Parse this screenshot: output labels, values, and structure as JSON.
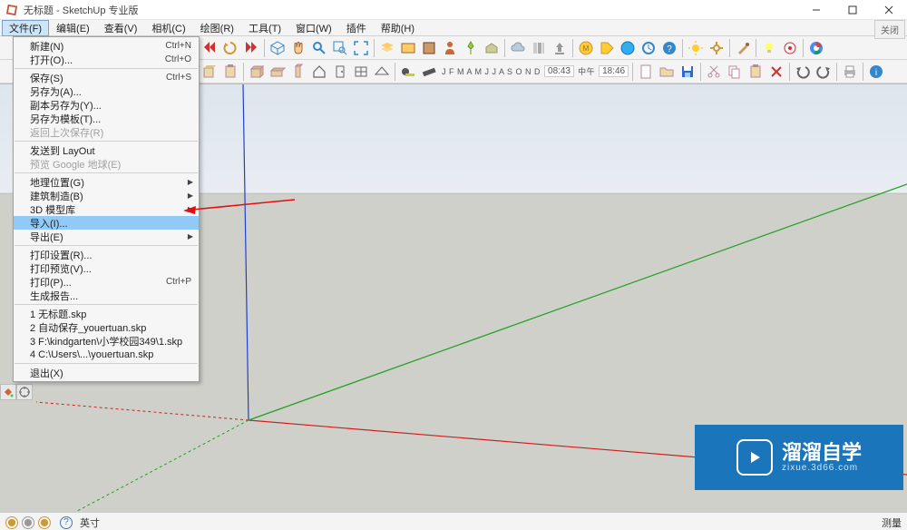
{
  "window": {
    "title": "无标题 - SketchUp 专业版",
    "close_tag": "关闭"
  },
  "menubar": [
    {
      "label": "文件(F)",
      "active": true
    },
    {
      "label": "编辑(E)"
    },
    {
      "label": "查看(V)"
    },
    {
      "label": "相机(C)"
    },
    {
      "label": "绘图(R)"
    },
    {
      "label": "工具(T)"
    },
    {
      "label": "窗口(W)"
    },
    {
      "label": "插件"
    },
    {
      "label": "帮助(H)"
    }
  ],
  "file_menu": {
    "groups": [
      [
        {
          "label": "新建(N)",
          "shortcut": "Ctrl+N"
        },
        {
          "label": "打开(O)...",
          "shortcut": "Ctrl+O"
        }
      ],
      [
        {
          "label": "保存(S)",
          "shortcut": "Ctrl+S"
        },
        {
          "label": "另存为(A)..."
        },
        {
          "label": "副本另存为(Y)..."
        },
        {
          "label": "另存为模板(T)..."
        },
        {
          "label": "返回上次保存(R)",
          "disabled": true
        }
      ],
      [
        {
          "label": "发送到 LayOut"
        },
        {
          "label": "预览 Google 地球(E)",
          "disabled": true
        }
      ],
      [
        {
          "label": "地理位置(G)",
          "submenu": true
        },
        {
          "label": "建筑制造(B)",
          "submenu": true
        },
        {
          "label": "3D 模型库",
          "submenu": true
        },
        {
          "label": "导入(I)...",
          "highlight": true
        },
        {
          "label": "导出(E)",
          "submenu": true
        }
      ],
      [
        {
          "label": "打印设置(R)..."
        },
        {
          "label": "打印预览(V)..."
        },
        {
          "label": "打印(P)...",
          "shortcut": "Ctrl+P"
        },
        {
          "label": "生成报告..."
        }
      ],
      [
        {
          "label": "1 无标题.skp"
        },
        {
          "label": "2 自动保存_youertuan.skp"
        },
        {
          "label": "3 F:\\kindgarten\\小学校园349\\1.skp"
        },
        {
          "label": "4 C:\\Users\\...\\youertuan.skp"
        }
      ],
      [
        {
          "label": "退出(X)"
        }
      ]
    ]
  },
  "toolbars": {
    "time_display_1": "08:43",
    "time_label": "中午",
    "time_display_2": "18:46",
    "months": "J F M A M J J A S O N D"
  },
  "watermark": {
    "main": "溜溜自学",
    "sub": "zixue.3d66.com"
  },
  "status": {
    "unit": "英寸",
    "measure_label": "测量"
  }
}
